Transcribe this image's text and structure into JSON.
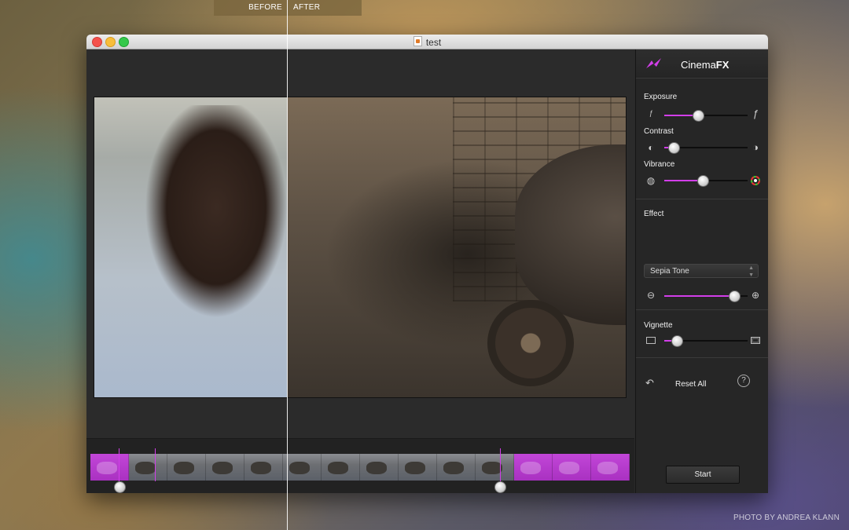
{
  "compare_bar": {
    "before_label": "BEFORE",
    "after_label": "AFTER"
  },
  "window": {
    "title": "test"
  },
  "panel": {
    "brand": {
      "name_prefix": "Cinema",
      "name_suffix": "FX"
    },
    "exposure": {
      "label": "Exposure",
      "value_percent": 40,
      "min_icon": "f-small-icon",
      "max_icon": "f-large-icon"
    },
    "contrast": {
      "label": "Contrast",
      "value_percent": 10,
      "min_icon": "contrast-low-icon",
      "max_icon": "contrast-high-icon"
    },
    "vibrance": {
      "label": "Vibrance",
      "value_percent": 45,
      "min_icon": "vibrance-low-icon",
      "max_icon": "color-wheel-icon"
    },
    "effect": {
      "label": "Effect",
      "selected": "Sepia Tone",
      "value_percent": 83,
      "min_icon": "minus-icon",
      "max_icon": "plus-icon"
    },
    "vignette": {
      "label": "Vignette",
      "value_percent": 14,
      "min_icon": "rectangle-icon",
      "max_icon": "vignette-icon"
    },
    "reset_label": "Reset All",
    "help_label": "?",
    "start_label": "Start"
  },
  "filmstrip": {
    "frame_count": 14,
    "selection_start_percent": 5,
    "selection_end_percent": 76
  },
  "credit": "PHOTO BY ANDREA KLANN",
  "colors": {
    "accent": "#d23ee9",
    "panel_bg": "#262626"
  }
}
